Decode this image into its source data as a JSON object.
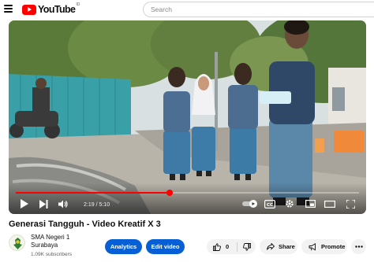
{
  "header": {
    "logo_text": "YouTube",
    "logo_country": "ID",
    "search_placeholder": "Search"
  },
  "player": {
    "current_time": "2:19",
    "duration": "5:10",
    "time_display": "2:19 / 5:10",
    "progress_fraction": 0.448,
    "accent_color": "#ff0000",
    "icons": [
      "play-icon",
      "next-icon",
      "volume-icon",
      "autoplay-toggle-icon",
      "captions-icon",
      "settings-icon",
      "miniplayer-icon",
      "theater-icon",
      "fullscreen-icon"
    ]
  },
  "video": {
    "title": "Generasi Tangguh - Video Kreatif X 3"
  },
  "channel": {
    "name": "SMA Negeri 1 Surabaya",
    "subscribers": "1.09K subscribers"
  },
  "actions": {
    "analytics_label": "Analytics",
    "edit_video_label": "Edit video",
    "like_count": "0",
    "share_label": "Share",
    "promote_label": "Promote",
    "button_color": "#065fd4"
  }
}
